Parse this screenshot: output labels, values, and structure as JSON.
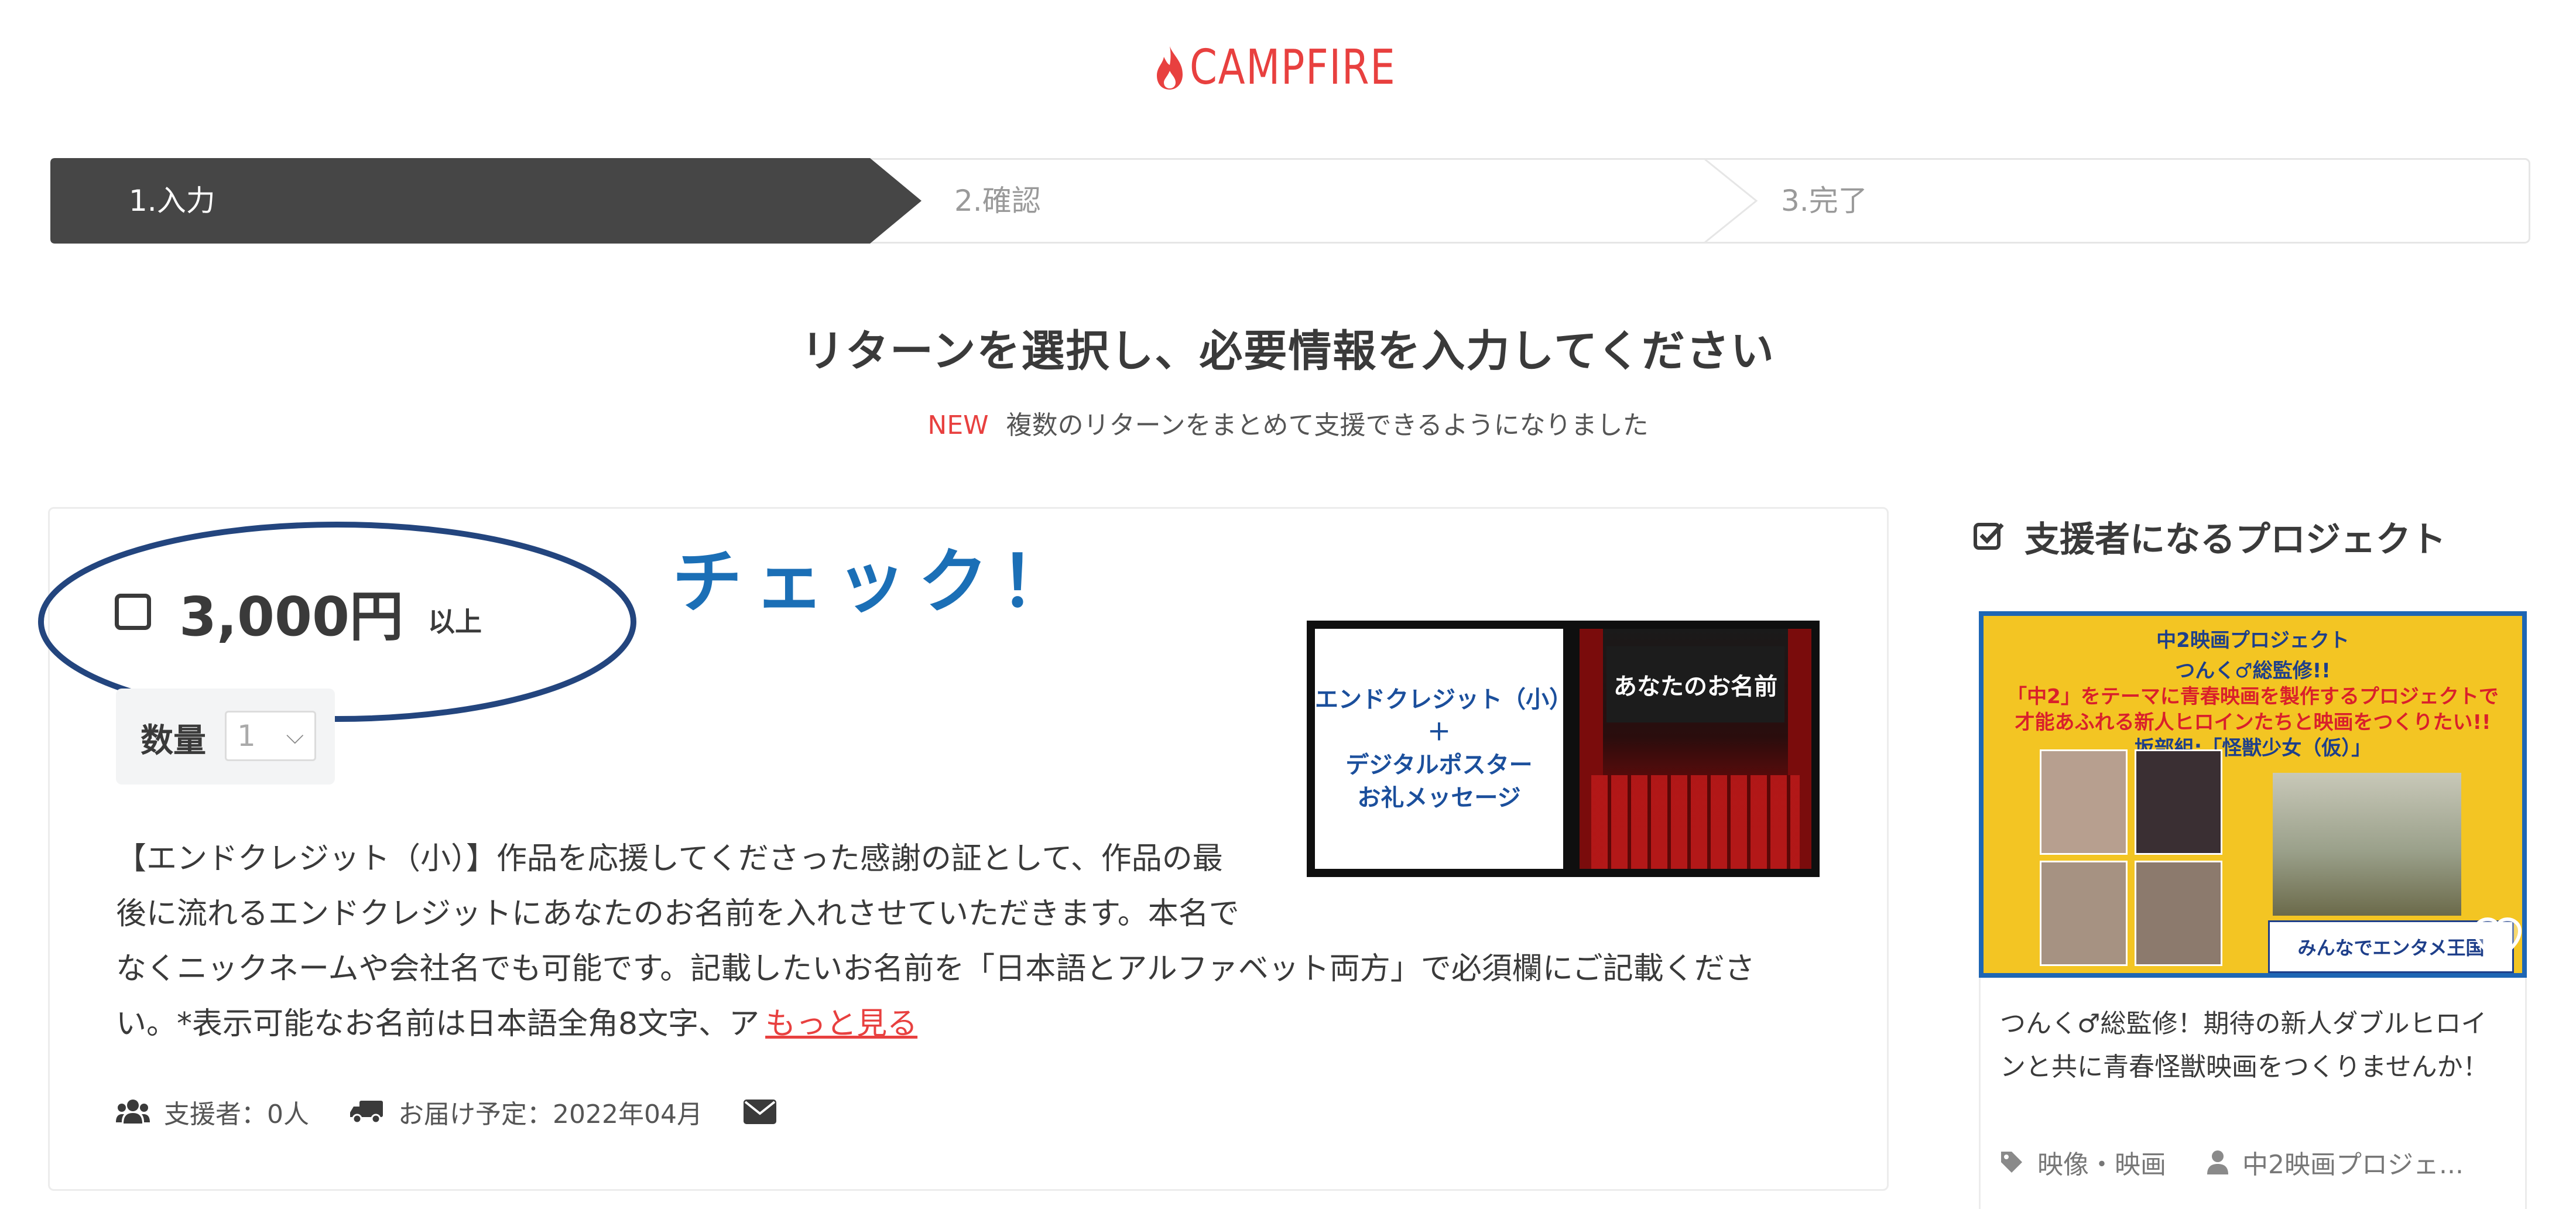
{
  "logo": {
    "text": "CAMPFIRE",
    "color": "#e8403f"
  },
  "steps": [
    {
      "label": "1.入力",
      "active": true
    },
    {
      "label": "2.確認",
      "active": false
    },
    {
      "label": "3.完了",
      "active": false
    }
  ],
  "page_title": "リターンを選択し、必要情報を入力してください",
  "notice": {
    "badge": "NEW",
    "text": "複数のリターンをまとめて支援できるようになりました"
  },
  "reward": {
    "price": "3,000円",
    "price_suffix": "以上",
    "quantity_label": "数量",
    "quantity_value": "1",
    "image": {
      "left_lines": [
        "エンドクレジット（小）",
        "＋",
        "デジタルポスター",
        "お礼メッセージ"
      ],
      "right_text": "あなたのお名前"
    },
    "description_lines": [
      "【エンドクレジット（小）】作品を応援してくださった感謝の証として、作品の最",
      "後に流れるエンドクレジットにあなたのお名前を入れさせていただきます。本名で",
      "なくニックネームや会社名でも可能です。記載したいお名前を「日本語とアルファベット両方」で必須欄にご記載くださ",
      "い。*表示可能なお名前は日本語全角8文字、ア"
    ],
    "more_link": "もっと見る",
    "supporters": "支援者：0人",
    "delivery": "お届け予定：2022年04月"
  },
  "annotation": {
    "text": "チェック！",
    "color": "#1b6fb6"
  },
  "sidebar": {
    "title": "支援者になるプロジェクト",
    "banner": {
      "title": "中2映画プロジェクト",
      "lines": [
        "つんく♂総監修!!",
        "「中2」をテーマに青春映画を製作するプロジェクトで",
        "才能あふれる新人ヒロインたちと映画をつくりたい!!",
        "坂部組:「怪獣少女（仮）」"
      ],
      "salon_text": "みんなでエンタメ王国"
    },
    "project_desc_lines": [
      "つんく♂総監修！期待の新人ダブルヒロイ",
      "ンと共に青春怪獣映画をつくりませんか！"
    ],
    "category": "映像・映画",
    "owner": "中2映画プロジェ..."
  }
}
